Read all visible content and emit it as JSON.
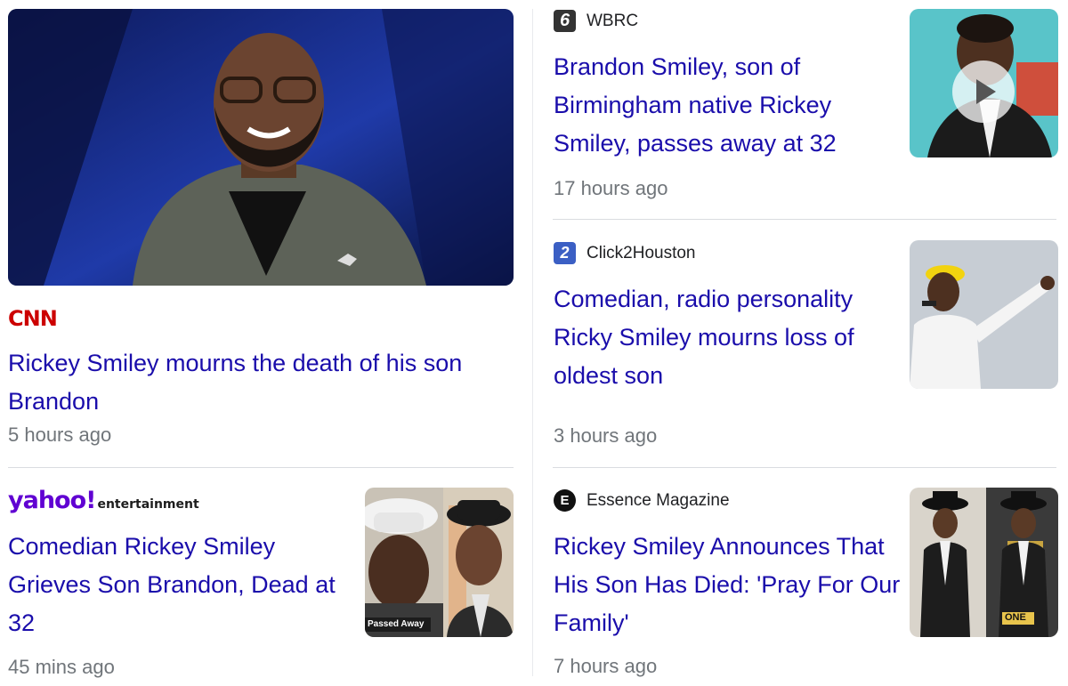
{
  "articles": [
    {
      "source": "CNN",
      "headline": "Rickey Smiley mourns the death of his son Brandon",
      "time": "5 hours ago"
    },
    {
      "source": "yahoo!entertainment",
      "source_brand": "yahoo!",
      "source_suffix": "entertainment",
      "headline": "Comedian Rickey Smiley Grieves Son Brandon, Dead at 32",
      "time": "45 mins ago",
      "thumb_caption": "Passed Away"
    },
    {
      "source": "WBRC",
      "favicon_glyph": "6",
      "headline": "Brandon Smiley, son of Birmingham native Rickey Smiley, passes away at 32",
      "time": "17 hours ago"
    },
    {
      "source": "Click2Houston",
      "favicon_glyph": "2",
      "headline": "Comedian, radio personality Ricky Smiley mourns loss of oldest son",
      "time": "3 hours ago"
    },
    {
      "source": "Essence Magazine",
      "favicon_glyph": "E",
      "headline": "Rickey Smiley Announces That His Son Has Died: 'Pray For Our Family'",
      "time": "7 hours ago",
      "thumb_caption": "ONE"
    }
  ],
  "colors": {
    "headline": "#1a0dab",
    "time": "#70757a",
    "cnn": "#cc0000",
    "yahoo": "#6001d2"
  }
}
